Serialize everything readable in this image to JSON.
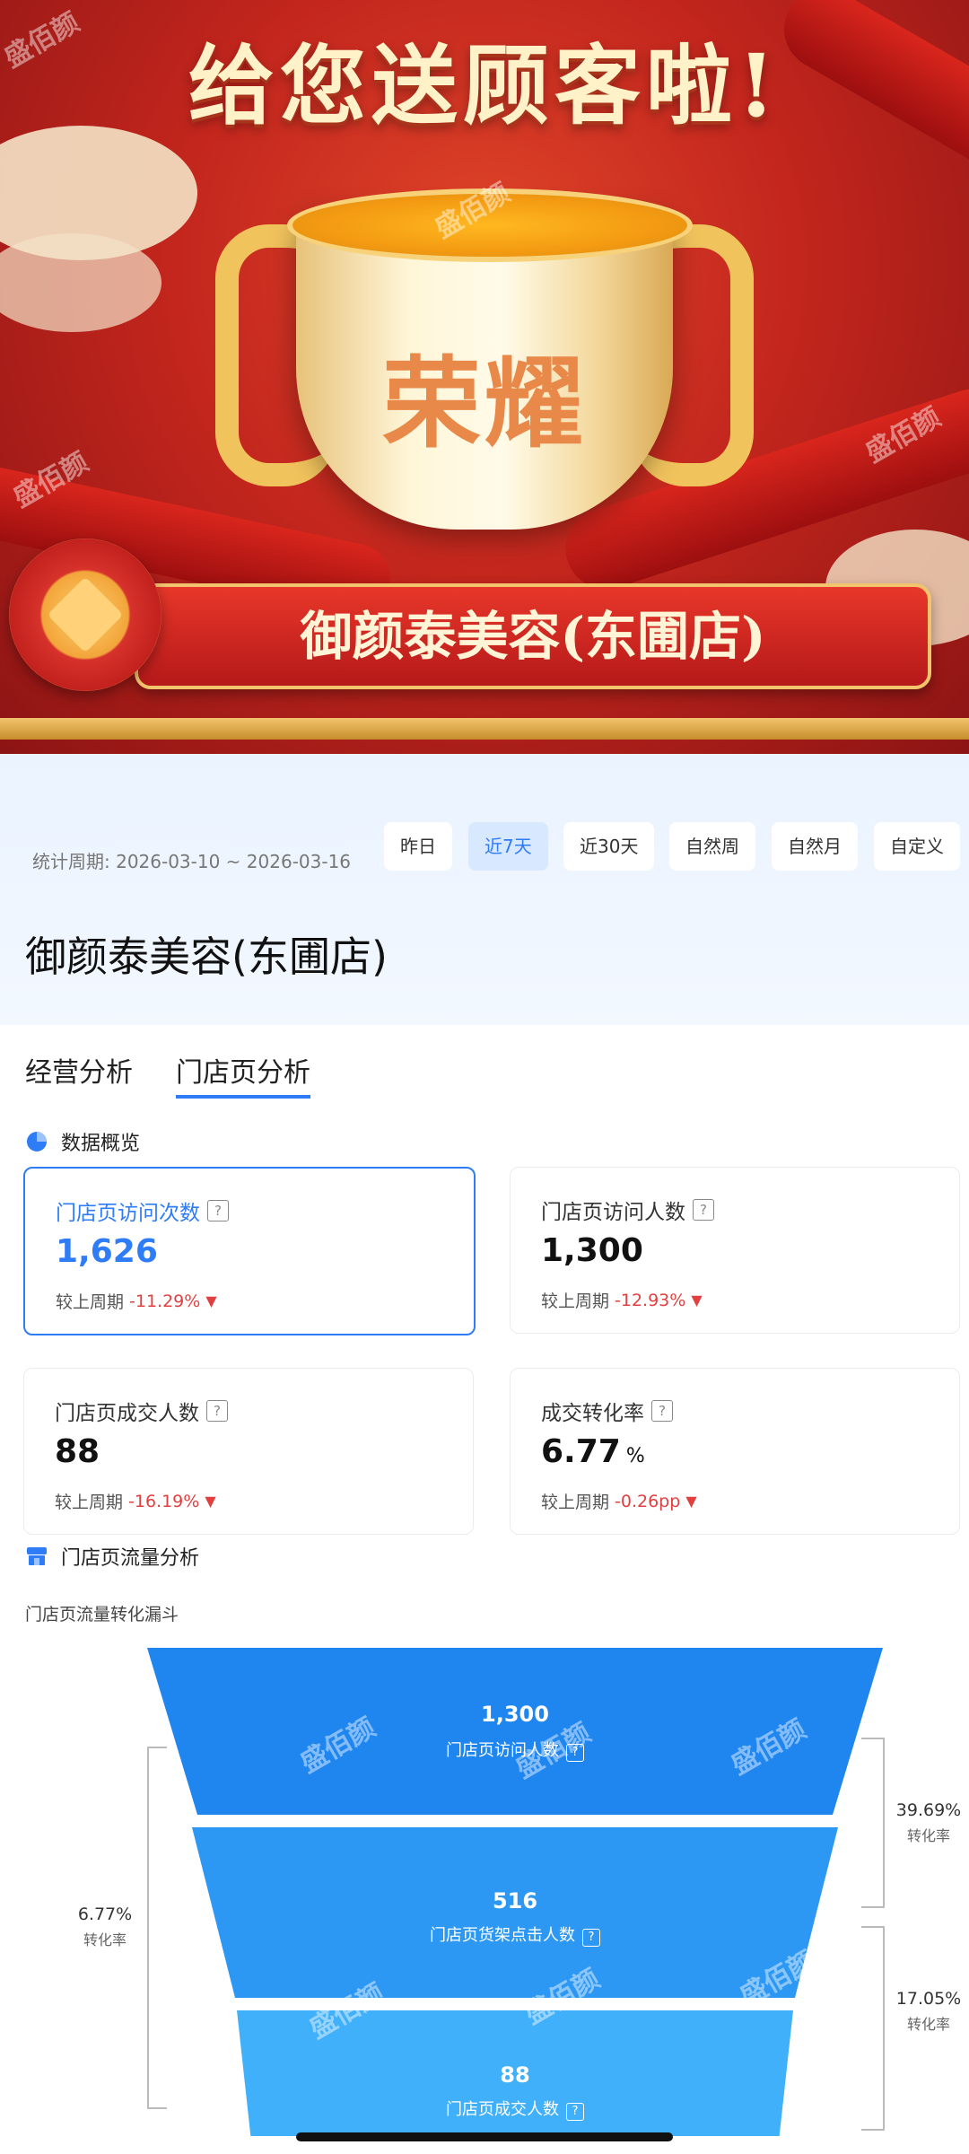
{
  "banner": {
    "headline": "给您送顾客啦!",
    "cup_text": "荣耀",
    "store_name": "御颜泰美容(东圃店)"
  },
  "header": {
    "period": "统计周期: 2026-03-10 ~ 2026-03-16",
    "ranges": [
      "昨日",
      "近7天",
      "近30天",
      "自然周",
      "自然月",
      "自定义"
    ],
    "active_range": "近7天",
    "store_title": "御颜泰美容(东圃店)"
  },
  "tabs": {
    "items": [
      "经营分析",
      "门店页分析"
    ],
    "active": "门店页分析"
  },
  "overview": {
    "title": "数据概览",
    "compare_prefix": "较上周期",
    "cards": [
      {
        "label": "门店页访问次数",
        "value": "1,626",
        "unit": "",
        "change": "-11.29%",
        "selected": true
      },
      {
        "label": "门店页访问人数",
        "value": "1,300",
        "unit": "",
        "change": "-12.93%",
        "selected": false
      },
      {
        "label": "门店页成交人数",
        "value": "88",
        "unit": "",
        "change": "-16.19%",
        "selected": false
      },
      {
        "label": "成交转化率",
        "value": "6.77",
        "unit": "%",
        "change": "-0.26pp",
        "selected": false
      }
    ]
  },
  "traffic": {
    "title": "门店页流量分析",
    "funnel_title": "门店页流量转化漏斗",
    "stages": [
      {
        "value": "1,300",
        "label": "门店页访问人数"
      },
      {
        "value": "516",
        "label": "门店页货架点击人数"
      },
      {
        "value": "88",
        "label": "门店页成交人数"
      }
    ],
    "rates": [
      {
        "value": "39.69%",
        "label": "转化率"
      },
      {
        "value": "17.05%",
        "label": "转化率"
      }
    ],
    "overall_rate": {
      "value": "6.77%",
      "label": "转化率"
    }
  },
  "watermark": "盛佰颜",
  "colors": {
    "primary": "#2e7cf6",
    "decline": "#e24040",
    "funnel_top": "#1f86f0",
    "funnel_mid": "#2c98f4",
    "funnel_bottom": "#41b0fa"
  },
  "icons": {
    "overview": "pie-chart-icon",
    "traffic": "store-icon",
    "decline": "arrow-down-icon",
    "help": "question-icon"
  }
}
